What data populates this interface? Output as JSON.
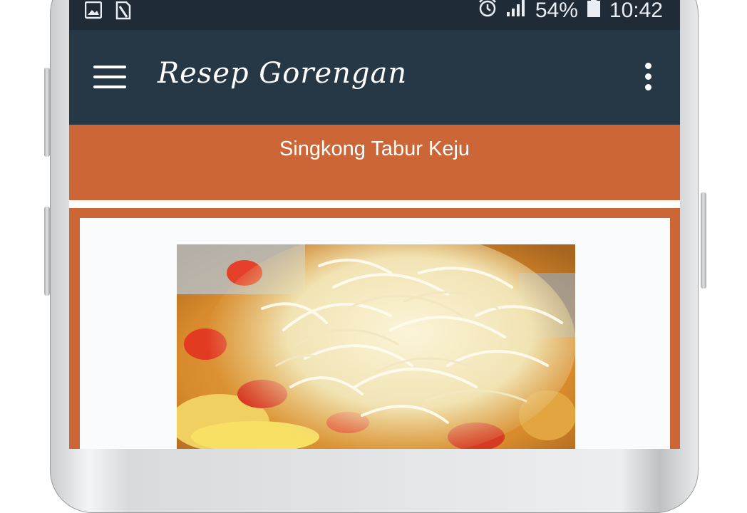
{
  "status_bar": {
    "icons_left": [
      "image-icon",
      "sim-card-icon"
    ],
    "icons_right": [
      "alarm-icon",
      "signal-icon",
      "battery-icon"
    ],
    "battery_percent": "54%",
    "time": "10:42",
    "background": "#1f2c38"
  },
  "app_bar": {
    "title": "Resep Gorengan",
    "menu_icon": "hamburger-menu-icon",
    "overflow_icon": "more-vert-icon",
    "background": "#263746"
  },
  "recipe": {
    "title": "Singkong Tabur Keju",
    "image_subject": "fried cassava topped with grated cheese",
    "accent_color": "#cd6636"
  }
}
